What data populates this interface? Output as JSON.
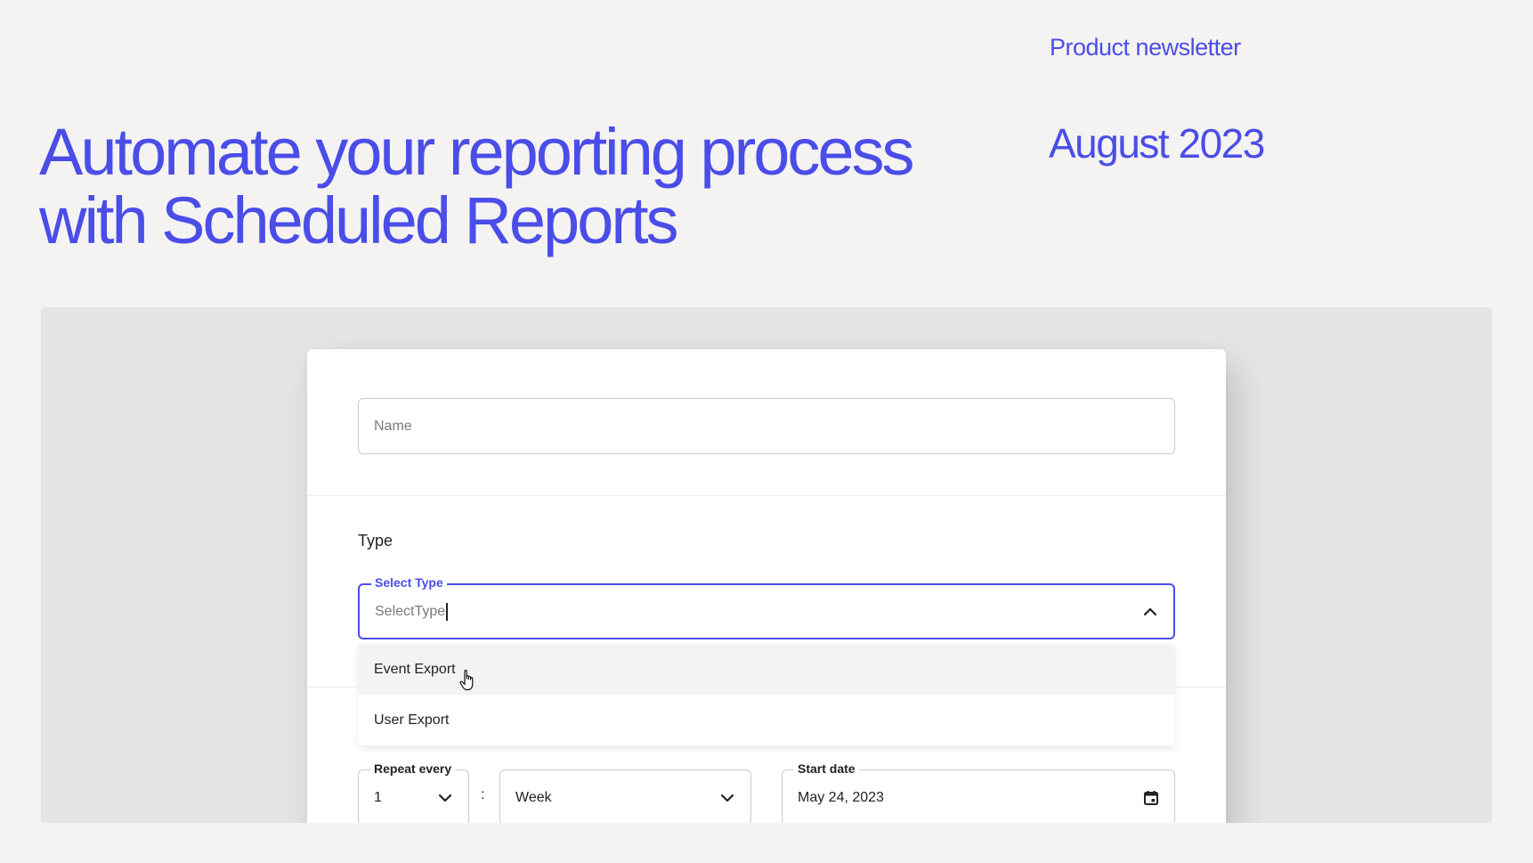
{
  "header": {
    "newsletter_label": "Product newsletter",
    "issue_date": "August 2023",
    "headline_line1": "Automate your reporting process",
    "headline_line2": "with Scheduled Reports"
  },
  "colors": {
    "accent": "#4b4de8",
    "page_background": "#f4f3f2",
    "showcase_background": "#e6e5e3"
  },
  "form": {
    "name_placeholder": "Name",
    "type_section_label": "Type",
    "select_type": {
      "legend": "Select Type",
      "value": "SelectType",
      "icon": "chevron-up-icon",
      "options": [
        "Event Export",
        "User Export"
      ],
      "hovered_option": "Event Export"
    },
    "repeat_every": {
      "legend": "Repeat every",
      "value": "1",
      "icon": "chevron-down-icon"
    },
    "separator": ":",
    "repeat_unit": {
      "value": "Week",
      "icon": "chevron-down-icon"
    },
    "start_date": {
      "legend": "Start date",
      "value": "May 24, 2023",
      "icon": "calendar-icon"
    }
  }
}
